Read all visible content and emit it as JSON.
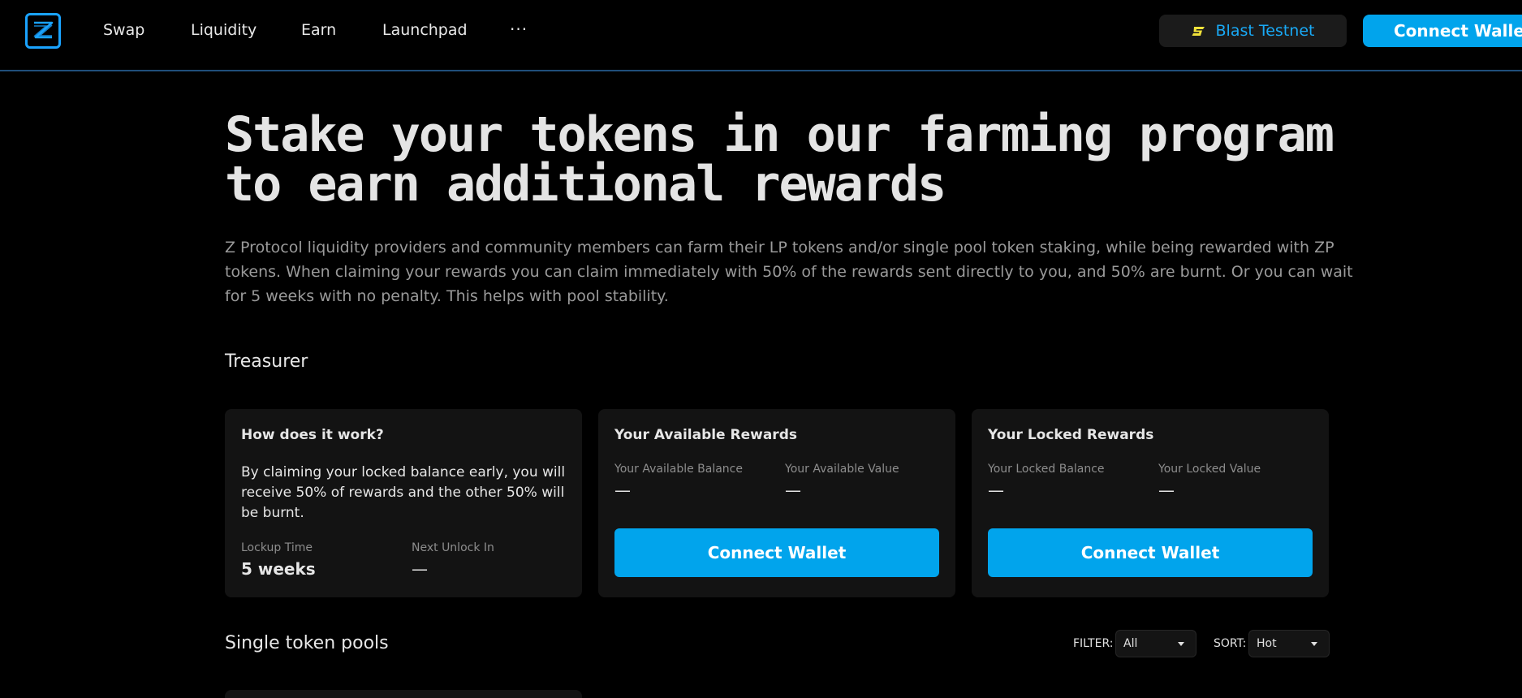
{
  "nav": {
    "logo": "z-protocol-logo-icon",
    "links": [
      "Swap",
      "Liquidity",
      "Earn",
      "Launchpad"
    ],
    "more": "···",
    "network_label": "Blast Testnet",
    "network_icon": "blast-icon",
    "connect_label": "Connect Wallet"
  },
  "hero": {
    "title": "Stake your tokens in our farming program to earn additional rewards",
    "description": "Z Protocol liquidity providers and community members can farm their LP tokens and/or single pool token staking, while being rewarded with ZP tokens. When claiming your rewards you can claim immediately with 50% of the rewards sent directly to you, and 50% are burnt. Or you can wait for 5 weeks with no penalty. This helps with pool stability."
  },
  "treasurer": {
    "title": "Treasurer",
    "how": {
      "title": "How does it work?",
      "text": "By claiming your locked balance early, you will receive 50% of rewards and the other 50% will be burnt.",
      "lockup_label": "Lockup Time",
      "lockup_value": "5 weeks",
      "unlock_label": "Next Unlock In",
      "unlock_value": "—"
    },
    "available": {
      "title": "Your Available Rewards",
      "balance_label": "Your Available Balance",
      "balance_value": "—",
      "value_label": "Your Available Value",
      "value_value": "—",
      "button": "Connect Wallet"
    },
    "locked": {
      "title": "Your Locked Rewards",
      "balance_label": "Your Locked Balance",
      "balance_value": "—",
      "value_label": "Your Locked Value",
      "value_value": "—",
      "button": "Connect Wallet"
    }
  },
  "pools": {
    "title": "Single token pools",
    "filter_label": "FILTER:",
    "filter_value": "All",
    "sort_label": "SORT:",
    "sort_value": "Hot"
  },
  "colors": {
    "accent": "#01a4ec",
    "network_text": "#19a9f5",
    "card_bg": "#131313",
    "background": "#000000"
  }
}
